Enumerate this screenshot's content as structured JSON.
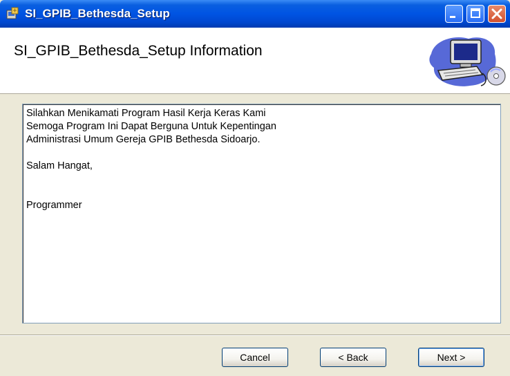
{
  "window": {
    "title": "SI_GPIB_Bethesda_Setup",
    "icon": "installer-icon"
  },
  "header": {
    "title": "SI_GPIB_Bethesda_Setup Information",
    "icon": "computer-setup-icon"
  },
  "content": {
    "lines": [
      "Silahkan Menikamati Program Hasil Kerja Keras Kami",
      "Semoga Program Ini Dapat Berguna Untuk Kepentingan",
      "Administrasi Umum Gereja GPIB Bethesda Sidoarjo.",
      "",
      "Salam Hangat,",
      "",
      "",
      "Programmer"
    ]
  },
  "buttons": {
    "cancel": "Cancel",
    "back": "< Back",
    "next": "Next >"
  },
  "colors": {
    "titlebar": "#0054e3",
    "window_bg": "#ece9d8",
    "close_button": "#d2502e"
  }
}
